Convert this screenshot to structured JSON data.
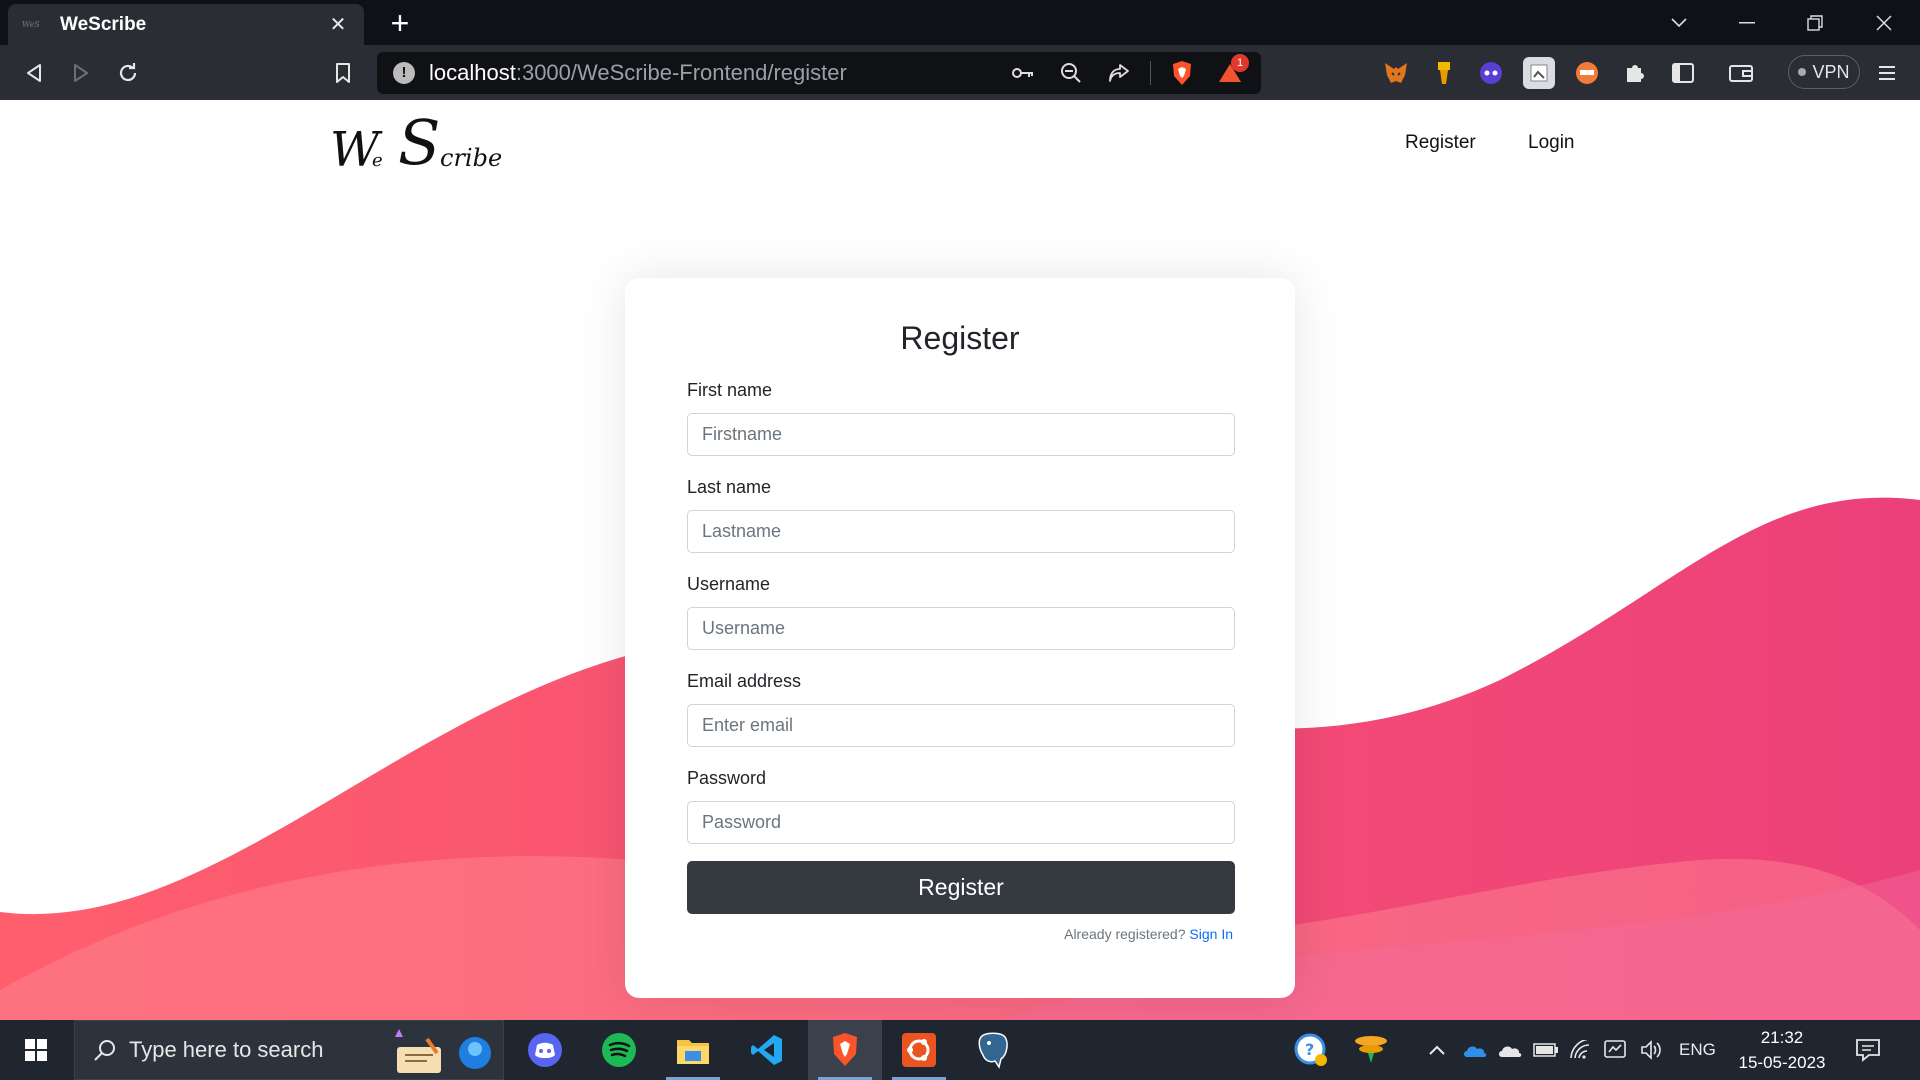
{
  "browser": {
    "tab_title": "WeScribe",
    "tab_close": "✕",
    "new_tab": "+",
    "url_host": "localhost",
    "url_path": ":3000/WeScribe-Frontend/register",
    "vpn_label": "VPN",
    "notification_count": "1"
  },
  "site": {
    "logo_text": "We Scribe",
    "nav": [
      "Register",
      "Login"
    ]
  },
  "form": {
    "title": "Register",
    "fields": [
      {
        "label": "First name",
        "placeholder": "Firstname",
        "value": ""
      },
      {
        "label": "Last name",
        "placeholder": "Lastname",
        "value": ""
      },
      {
        "label": "Username",
        "placeholder": "Username",
        "value": ""
      },
      {
        "label": "Email address",
        "placeholder": "Enter email",
        "value": ""
      },
      {
        "label": "Password",
        "placeholder": "Password",
        "value": ""
      }
    ],
    "submit_label": "Register",
    "footer_text": "Already registered?",
    "footer_link": "Sign In"
  },
  "taskbar": {
    "search_placeholder": "Type here to search",
    "language": "ENG",
    "time": "21:32",
    "date": "15-05-2023"
  },
  "colors": {
    "wave_start": "#ff5f6d",
    "wave_end": "#ec407a",
    "button": "#343a40",
    "link": "#0d6efd"
  }
}
